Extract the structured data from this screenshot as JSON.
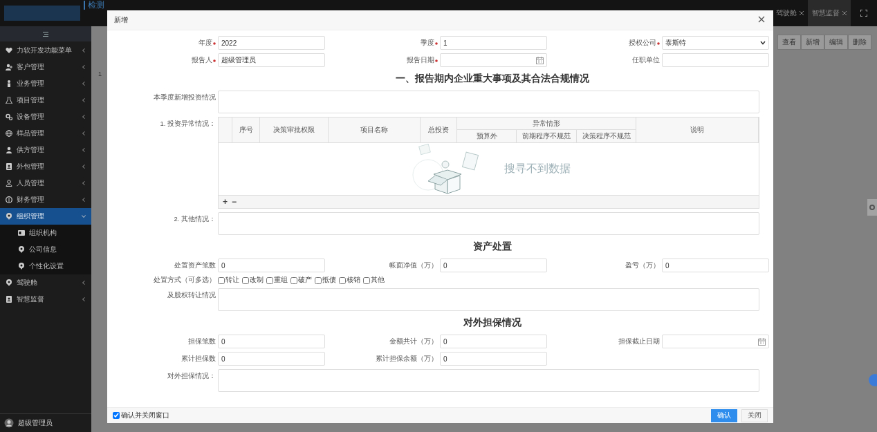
{
  "header": {
    "title": "检测",
    "tabs": [
      {
        "label": "驾驶舱",
        "selected": false
      },
      {
        "label": "智慧监督",
        "selected": true
      }
    ]
  },
  "sidebar": {
    "items": [
      {
        "label": "力软开发功能菜单",
        "selected": false,
        "expanded": false
      },
      {
        "label": "客户管理",
        "selected": false,
        "expanded": false
      },
      {
        "label": "业务管理",
        "selected": false,
        "expanded": false
      },
      {
        "label": "项目管理",
        "selected": false,
        "expanded": false
      },
      {
        "label": "设备管理",
        "selected": false,
        "expanded": false
      },
      {
        "label": "样品管理",
        "selected": false,
        "expanded": false
      },
      {
        "label": "供方管理",
        "selected": false,
        "expanded": false
      },
      {
        "label": "外包管理",
        "selected": false,
        "expanded": false
      },
      {
        "label": "人员管理",
        "selected": false,
        "expanded": false
      },
      {
        "label": "财务管理",
        "selected": false,
        "expanded": false
      },
      {
        "label": "组织管理",
        "selected": true,
        "expanded": true,
        "children": [
          {
            "label": "组织机构"
          },
          {
            "label": "公司信息"
          },
          {
            "label": "个性化设置"
          }
        ]
      },
      {
        "label": "驾驶舱",
        "selected": false,
        "expanded": false
      },
      {
        "label": "智慧监督",
        "selected": false,
        "expanded": false
      }
    ],
    "user": "超级管理员"
  },
  "background": {
    "toolbar": [
      "查看",
      "新增",
      "编辑",
      "删除"
    ],
    "row_number": "1"
  },
  "modal": {
    "title": "新增",
    "form": [
      {
        "kind": "row",
        "fields": [
          {
            "label": "年度",
            "required": true,
            "kind": "text",
            "value": "2022"
          },
          {
            "label": "季度",
            "required": true,
            "kind": "text",
            "value": "1"
          },
          {
            "label": "授权公司",
            "required": true,
            "kind": "select",
            "value": "泰斯特"
          }
        ]
      },
      {
        "kind": "row",
        "fields": [
          {
            "label": "报告人",
            "required": true,
            "kind": "text",
            "value": "超级管理员"
          },
          {
            "label": "报告日期",
            "required": true,
            "kind": "date"
          },
          {
            "label": "任职单位",
            "required": false,
            "kind": "text"
          }
        ]
      },
      {
        "kind": "heading",
        "text": "一、报告期内企业重大事项及其合法合规情况"
      },
      {
        "kind": "textarea",
        "label": "本季度新增投资情况"
      },
      {
        "kind": "table",
        "label": "1. 投资异常情况：",
        "columns": [
          "序号",
          "决策审批权限",
          "项目名称",
          "总投资"
        ],
        "group": {
          "label": "异常情形",
          "columns": [
            "预算外",
            "前期程序不规范",
            "决策程序不规范"
          ]
        },
        "last_column": "说明",
        "empty_text": "搜寻不到数据",
        "actions": [
          "+",
          "−"
        ]
      },
      {
        "kind": "textarea",
        "label": "2. 其他情况："
      },
      {
        "kind": "heading",
        "text": "资产处置"
      },
      {
        "kind": "row",
        "fields": [
          {
            "label": "处置资产笔数",
            "required": false,
            "kind": "text",
            "value": "0"
          },
          {
            "label": "帐面净值（万）",
            "required": false,
            "kind": "text",
            "value": "0"
          },
          {
            "label": "盈亏（万）",
            "required": false,
            "kind": "text",
            "value": "0"
          }
        ]
      },
      {
        "kind": "checkboxes",
        "label": "处置方式（可多选）",
        "options": [
          {
            "label": "转让",
            "checked": false
          },
          {
            "label": "改制",
            "checked": false
          },
          {
            "label": "重组",
            "checked": false
          },
          {
            "label": "破产",
            "checked": false
          },
          {
            "label": "抵债",
            "checked": false
          },
          {
            "label": "核销",
            "checked": false
          },
          {
            "label": "其他",
            "checked": false
          }
        ]
      },
      {
        "kind": "textarea",
        "label": "及股权转让情况"
      },
      {
        "kind": "heading",
        "text": "对外担保情况"
      },
      {
        "kind": "row",
        "fields": [
          {
            "label": "担保笔数",
            "required": false,
            "kind": "text",
            "value": "0"
          },
          {
            "label": "金额共计（万）",
            "required": false,
            "kind": "text",
            "value": "0"
          },
          {
            "label": "担保截止日期",
            "required": false,
            "kind": "date"
          }
        ]
      },
      {
        "kind": "row",
        "fields": [
          {
            "label": "累计担保数",
            "required": false,
            "kind": "text",
            "value": "0"
          },
          {
            "label": "累计担保余额（万）",
            "required": false,
            "kind": "text",
            "value": "0"
          }
        ]
      },
      {
        "kind": "textarea",
        "label": "对外担保情况："
      }
    ],
    "footer": {
      "checkbox": {
        "label": "确认并关闭窗口",
        "checked": true
      },
      "buttons": [
        {
          "label": "确认",
          "kind": "primary"
        },
        {
          "label": "关闭",
          "kind": "default"
        }
      ]
    }
  }
}
